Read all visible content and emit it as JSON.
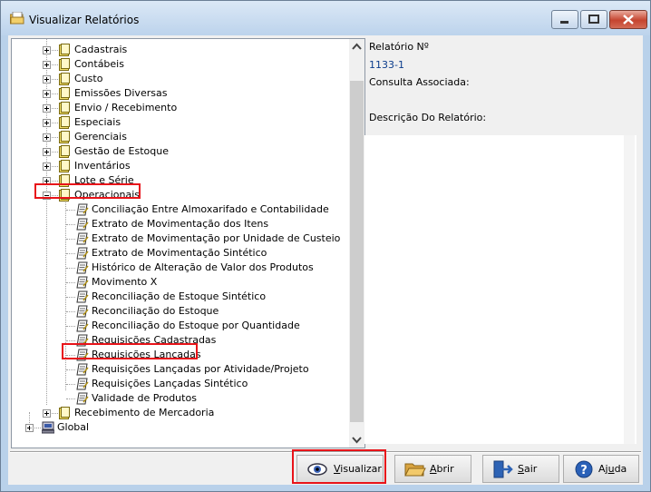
{
  "window": {
    "title": "Visualizar Relatórios"
  },
  "tree": {
    "groups_before": [
      "Cadastrais",
      "Contábeis",
      "Custo",
      "Emissões Diversas",
      "Envio / Recebimento",
      "Especiais",
      "Gerenciais",
      "Gestão de Estoque",
      "Inventários",
      "Lote e Série"
    ],
    "expanded_group": "Operacionais",
    "reports": [
      "Conciliação Entre Almoxarifado e Contabilidade",
      "Extrato de Movimentação dos Itens",
      "Extrato de Movimentação por Unidade de Custeio",
      "Extrato de Movimentação Sintético",
      "Histórico de Alteração de Valor dos Produtos",
      "Movimento X",
      "Reconciliação de Estoque Sintético",
      "Reconciliação do Estoque",
      "Reconciliação do Estoque por Quantidade",
      "Requisições Cadastradas",
      "Requisições Lançadas",
      "Requisições Lançadas por Atividade/Projeto",
      "Requisições Lançadas Sintético",
      "Validade de Produtos"
    ],
    "selected_report": "Requisições Lançadas",
    "groups_after": [
      "Recebimento de Mercadoria"
    ],
    "root": "Global"
  },
  "details": {
    "report_number_label": "Relatório Nº",
    "report_number_value": "1133-1",
    "associated_query_label": "Consulta Associada:",
    "description_label": "Descrição Do Relatório:"
  },
  "buttons": {
    "view": {
      "pre": "",
      "key": "V",
      "post": "isualizar"
    },
    "open": {
      "pre": "",
      "key": "A",
      "post": "brir"
    },
    "exit": {
      "pre": "",
      "key": "S",
      "post": "air"
    },
    "help": {
      "pre": "Aj",
      "key": "u",
      "post": "da"
    }
  },
  "colors": {
    "highlight": "#e8141a",
    "value_text": "#0b3c8c",
    "folder": "#e8d23a"
  }
}
